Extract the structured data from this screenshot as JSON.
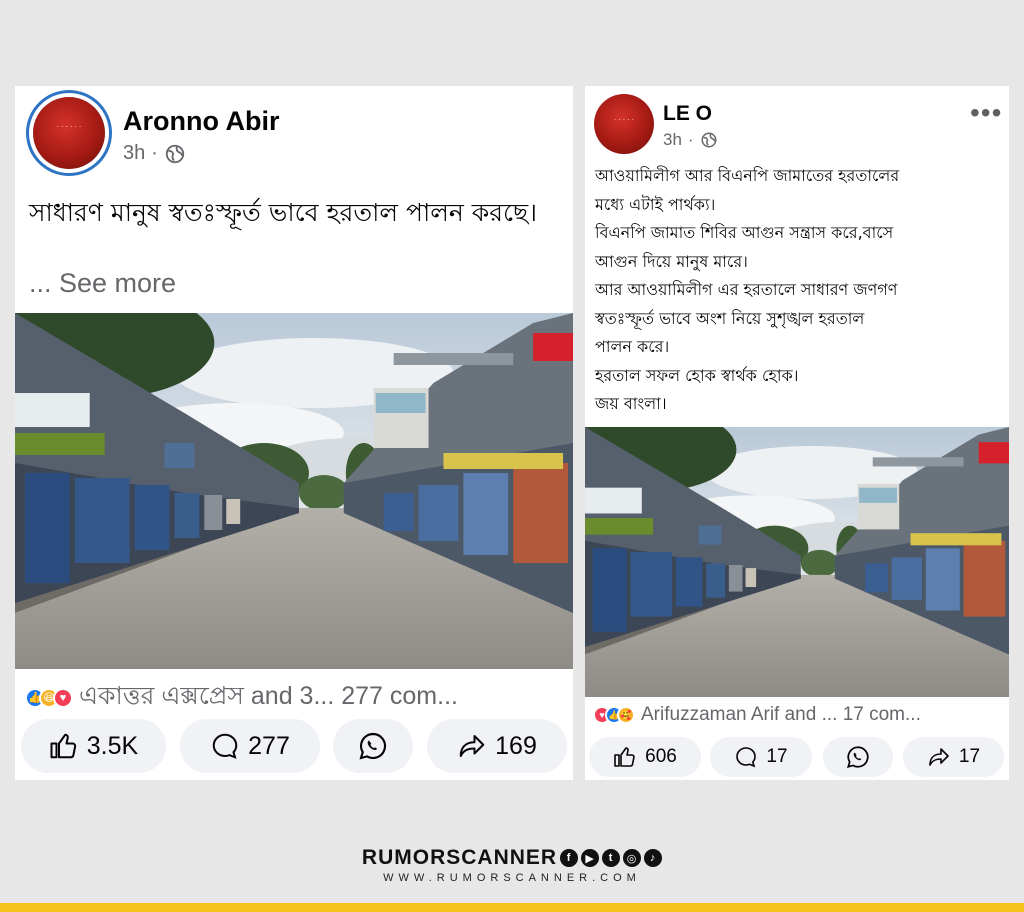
{
  "post1": {
    "author": "Aronno Abir",
    "time": "3h",
    "dot": "·",
    "text": "সাধারণ মানুষ স্বতঃস্ফূর্ত ভাবে হরতাল পালন করছে।",
    "see_more": "... See more",
    "reactions_summary": "একাত্তর এক্সপ্রেস and 3... 277 com...",
    "actions": {
      "like": "3.5K",
      "comment": "277",
      "share": "169"
    }
  },
  "post2": {
    "author": "LE O",
    "time": "3h",
    "dot": "·",
    "menu": "•••",
    "text_lines": [
      "আওয়ামিলীগ আর বিএনপি জামাতের হরতালের",
      "মধ্যে এটাই পার্থক্য।",
      "বিএনপি জামাত শিবির আগুন সন্ত্রাস করে,বাসে",
      "আগুন দিয়ে মানুষ মারে।",
      "আর আওয়ামিলীগ এর হরতালে সাধারণ জণগণ",
      "স্বতঃস্ফূর্ত ভাবে অংশ নিয়ে সুশৃঙ্খল হরতাল",
      "পালন করে।",
      "হরতাল সফল হোক স্বার্থক হোক।",
      "জয় বাংলা।"
    ],
    "reactions_summary": "Arifuzzaman Arif and ... 17 com...",
    "actions": {
      "like": "606",
      "comment": "17",
      "share": "17"
    }
  },
  "photo_signs": {
    "footwear": "IENDS FOOTWEAR",
    "lux": "LUX",
    "nit": "NIT",
    "raj": "RAJK"
  },
  "brand": {
    "name": "RUMORSCANNER",
    "url": "WWW.RUMORSCANNER.COM",
    "social_icons": [
      "facebook-icon",
      "youtube-icon",
      "twitter-icon",
      "instagram-icon",
      "tiktok-icon"
    ]
  },
  "colors": {
    "accent_blue": "#1877f2",
    "brand_yellow": "#f6c21b",
    "avatar_red": "#b3201a"
  }
}
